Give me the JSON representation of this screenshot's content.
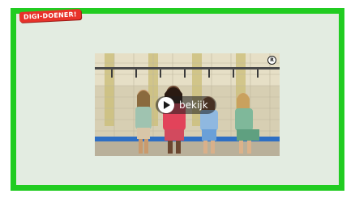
{
  "badge": {
    "text": "DIGI-DOENER!"
  },
  "video": {
    "play_label": "bekijk",
    "logo_mark": "R"
  },
  "colors": {
    "frame_border": "#21cc21",
    "frame_fill": "#e3ece1",
    "badge_fill": "#e8322a",
    "play_overlay": "#1e1e1e"
  },
  "icons": {
    "play": "play-icon",
    "logo": "channel-logo-icon"
  }
}
